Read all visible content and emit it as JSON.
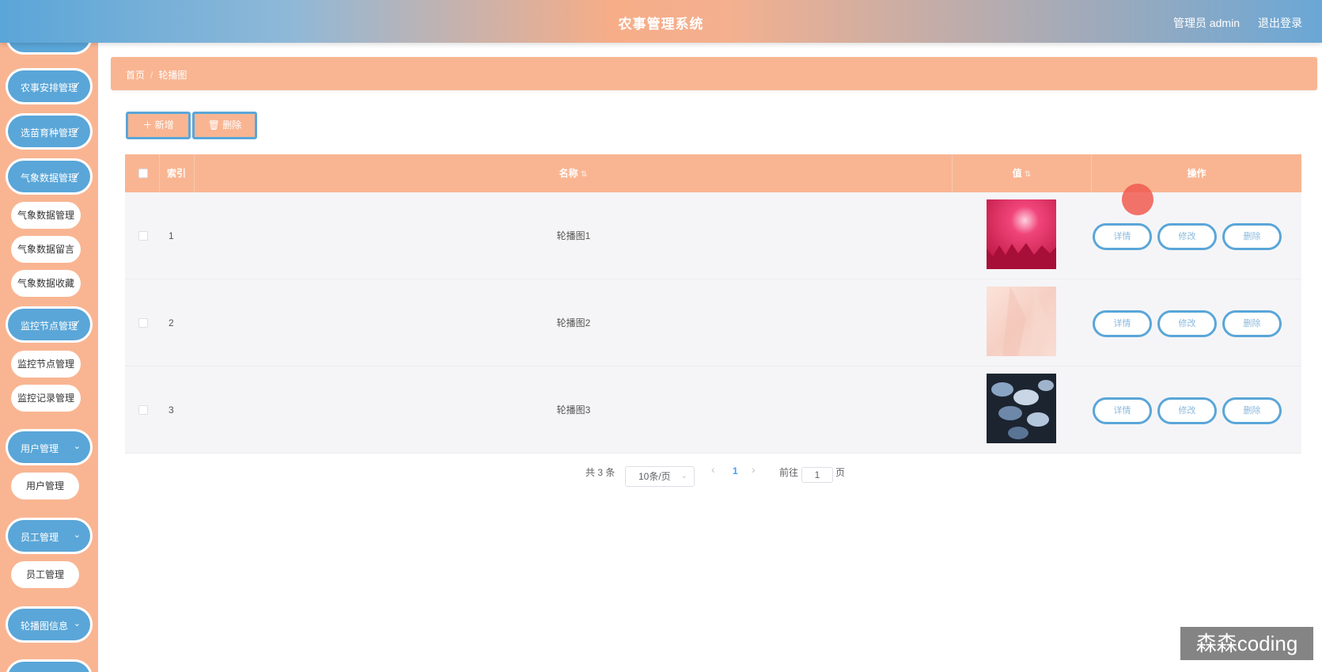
{
  "header": {
    "title": "农事管理系统",
    "user": "管理员 admin",
    "logout": "退出登录"
  },
  "sidebar": {
    "groups": [
      {
        "label": "农事安排管理",
        "chevron": "✓"
      },
      {
        "label": "选苗育种管理",
        "chevron": "✓"
      },
      {
        "label": "气象数据管理",
        "chevron": "✓"
      },
      {
        "label": "监控节点管理",
        "chevron": "✓"
      },
      {
        "label": "用户管理",
        "chevron": "⌄"
      },
      {
        "label": "员工管理",
        "chevron": "⌄"
      },
      {
        "label": "轮播图信息",
        "chevron": "⌄"
      }
    ],
    "subitems": [
      "气象数据管理",
      "气象数据留言",
      "气象数据收藏",
      "监控节点管理",
      "监控记录管理",
      "用户管理",
      "员工管理"
    ]
  },
  "breadcrumb": {
    "home": "首页",
    "sep": "/",
    "current": "轮播图"
  },
  "toolbar": {
    "add": "＋ 新增",
    "delete": "🗑 删除"
  },
  "table": {
    "headers": {
      "index": "索引",
      "name": "名称",
      "value": "值",
      "actions": "操作",
      "sort": "⇅"
    },
    "rows": [
      {
        "index": "1",
        "name": "轮播图1"
      },
      {
        "index": "2",
        "name": "轮播图2"
      },
      {
        "index": "3",
        "name": "轮播图3"
      }
    ],
    "actions": {
      "detail": "详情",
      "edit": "修改",
      "delete": "删除"
    }
  },
  "pagination": {
    "total": "共 3 条",
    "page_size": "10条/页",
    "prev": "‹",
    "current": "1",
    "next": "›",
    "goto": "前往",
    "goto_value": "1",
    "page_unit": "页"
  },
  "watermark": "森森coding",
  "colors": {
    "primary": "#5aa6d8",
    "accent": "#f9b592"
  }
}
